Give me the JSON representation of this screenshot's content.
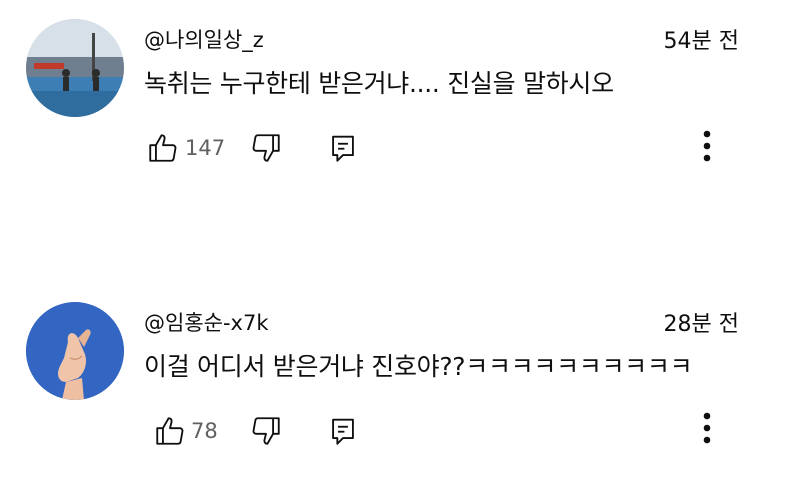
{
  "comments": [
    {
      "handle": "@나의일상_z",
      "time": "54분 전",
      "text": "녹취는 누구한테 받은거냐.... 진실을 말하시오",
      "likes": "147"
    },
    {
      "handle": "@임홍순-x7k",
      "time": "28분 전",
      "text": "이걸 어디서 받은거냐  진호야??ㅋㅋㅋㅋㅋㅋㅋㅋㅋㅋ",
      "likes": "78"
    }
  ],
  "icons": {
    "like": "thumbs-up-icon",
    "dislike": "thumbs-down-icon",
    "reply": "reply-icon",
    "more": "more-vertical-icon"
  }
}
